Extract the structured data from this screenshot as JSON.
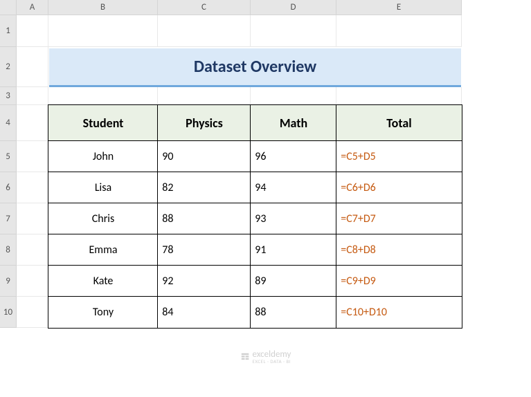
{
  "columns": [
    "A",
    "B",
    "C",
    "D",
    "E"
  ],
  "rows": [
    "1",
    "2",
    "3",
    "4",
    "5",
    "6",
    "7",
    "8",
    "9",
    "10"
  ],
  "title": "Dataset Overview",
  "headers": {
    "student": "Student",
    "physics": "Physics",
    "math": "Math",
    "total": "Total"
  },
  "data": [
    {
      "student": "John",
      "physics": "90",
      "math": "96",
      "total": "=C5+D5"
    },
    {
      "student": "Lisa",
      "physics": "82",
      "math": "94",
      "total": "=C6+D6"
    },
    {
      "student": "Chris",
      "physics": "88",
      "math": "93",
      "total": "=C7+D7"
    },
    {
      "student": "Emma",
      "physics": "78",
      "math": "91",
      "total": "=C8+D8"
    },
    {
      "student": "Kate",
      "physics": "92",
      "math": "89",
      "total": "=C9+D9"
    },
    {
      "student": "Tony",
      "physics": "84",
      "math": "88",
      "total": "=C10+D10"
    }
  ],
  "watermark": {
    "brand": "exceldemy",
    "sub": "EXCEL · DATA · BI"
  }
}
